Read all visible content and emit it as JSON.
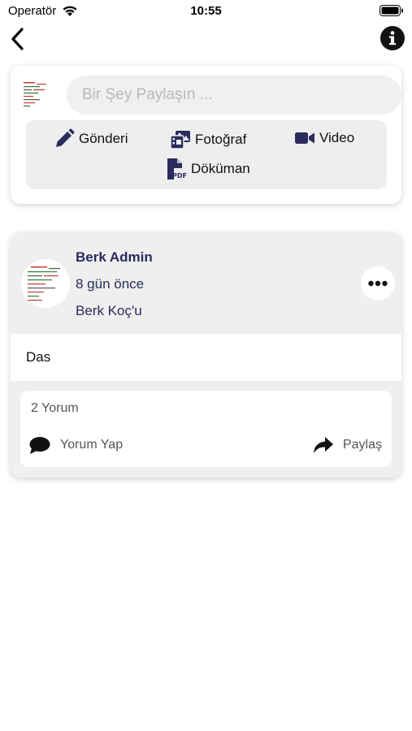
{
  "status_bar": {
    "carrier": "Operatör",
    "time": "10:55"
  },
  "composer": {
    "placeholder": "Bir Şey Paylaşın ...",
    "actions": {
      "post_label": "Gönderi",
      "photo_label": "Fotoğraf",
      "video_label": "Video",
      "document_label": "Döküman"
    }
  },
  "post": {
    "author": "Berk Admin",
    "time_ago": "8 gün önce",
    "target": "Berk Koç'u",
    "text": "Das",
    "comment_count": "2 Yorum",
    "comment_label": "Yorum Yap",
    "share_label": "Paylaş"
  },
  "icons": [
    "back-icon",
    "info-icon",
    "pencil-icon",
    "photos-icon",
    "video-camera-icon",
    "pdf-file-icon",
    "more-icon",
    "comment-icon",
    "share-icon"
  ]
}
